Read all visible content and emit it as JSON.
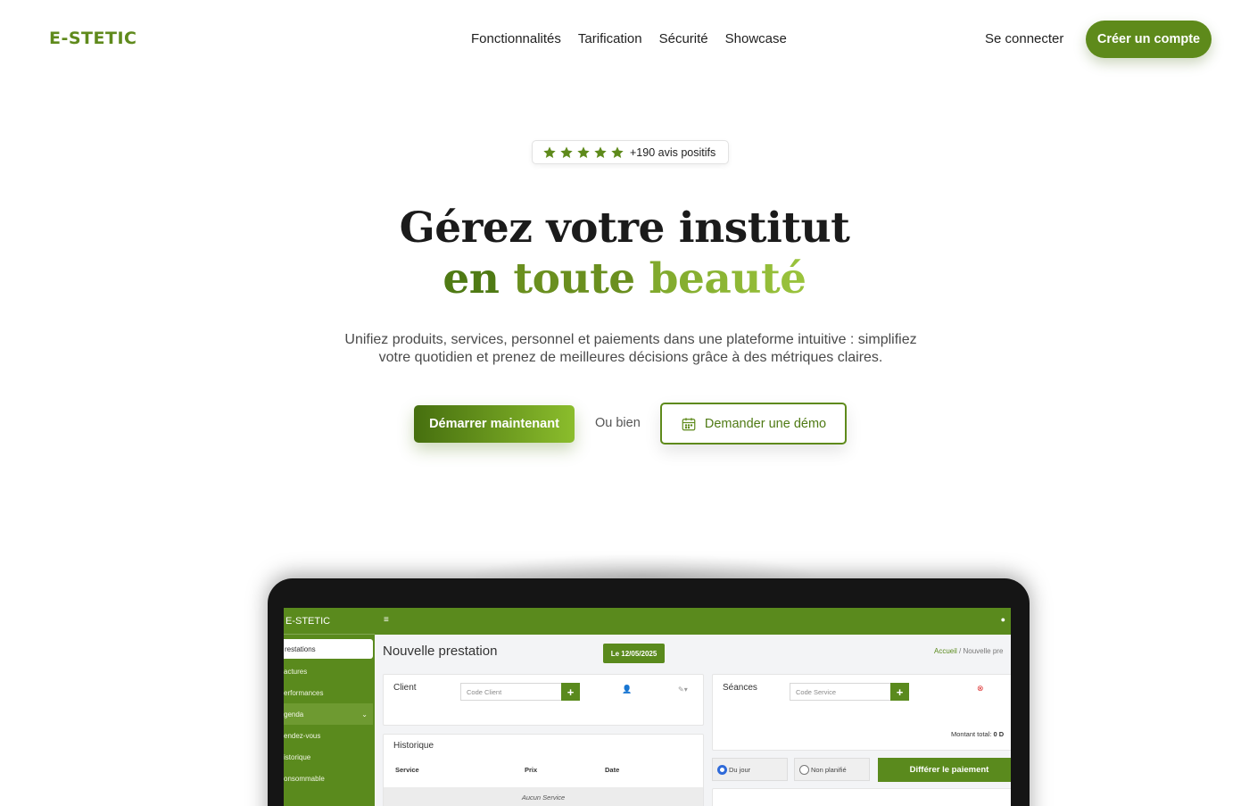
{
  "brand": "E-STETIC",
  "nav": {
    "links": [
      "Fonctionnalités",
      "Tarification",
      "Sécurité",
      "Showcase"
    ],
    "signin": "Se connecter",
    "cta": "Créer un compte"
  },
  "badge": {
    "rating_stars": 5,
    "text": "+190 avis positifs"
  },
  "hero": {
    "title_line1": "Gérez votre institut",
    "title_line2": [
      "en",
      "toute",
      "beauté"
    ],
    "subtitle_line1": "Unifiez produits, services, personnel et paiements dans une plateforme intuitive : simplifiez",
    "subtitle_line2": "votre quotidien et prenez de meilleures décisions grâce à des métriques claires.",
    "primary_button": "Démarrer maintenant",
    "or_text": "Ou bien",
    "demo_button": "Demander une démo"
  },
  "colors": {
    "accent": "#5e8a1b",
    "accent_light": "#8bbd2c",
    "app_green": "#5a8a1d"
  },
  "app": {
    "brand": "E-STETIC",
    "sidebar": [
      {
        "label": "restations",
        "state": "active"
      },
      {
        "label": "actures",
        "state": "normal"
      },
      {
        "label": "erformances",
        "state": "normal"
      },
      {
        "label": "genda",
        "state": "open"
      },
      {
        "label": "endez-vous",
        "state": "normal"
      },
      {
        "label": "istorique",
        "state": "normal"
      },
      {
        "label": "onsommable",
        "state": "normal"
      }
    ],
    "page_title": "Nouvelle prestation",
    "date_pill": "Le 12/05/2025",
    "breadcrumb": {
      "home": "Accueil",
      "sep": "/",
      "current": "Nouvelle pre"
    },
    "client": {
      "label": "Client",
      "placeholder": "Code Client"
    },
    "seances": {
      "label": "Séances",
      "placeholder": "Code Service"
    },
    "historique": {
      "label": "Historique",
      "columns": [
        "Service",
        "Prix",
        "Date"
      ],
      "empty": "Aucun Service"
    },
    "total_label": "Montant total:",
    "total_value": "0 D",
    "radios": [
      {
        "label": "Du jour",
        "checked": true
      },
      {
        "label": "Non planifié",
        "checked": false
      }
    ],
    "defer_button": "Différer le paiement"
  }
}
